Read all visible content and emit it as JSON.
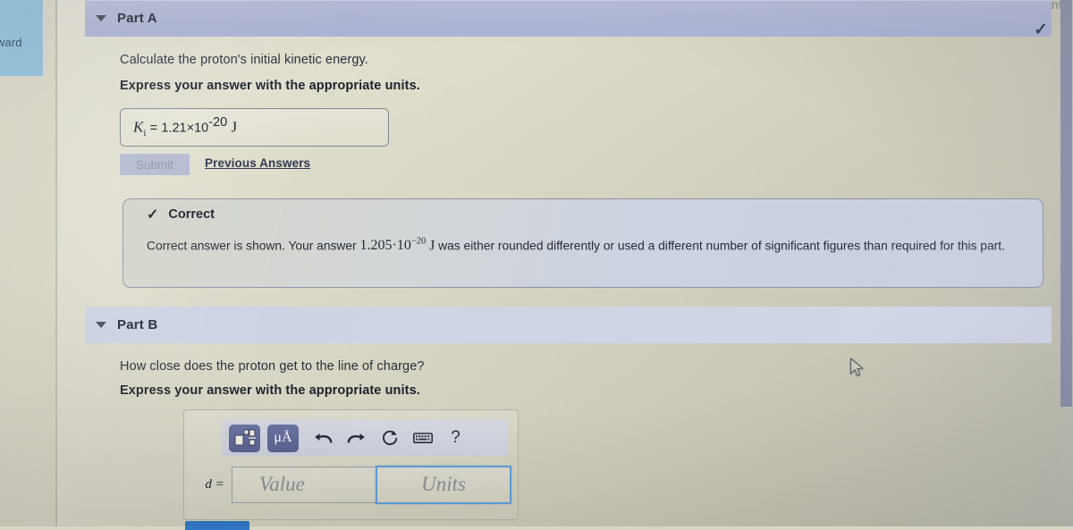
{
  "app": {
    "constants_label": "Constants",
    "left_nav_chip_text": "ward"
  },
  "part_a": {
    "title": "Part A",
    "caret_icon": "caret-down-icon",
    "status_icon": "check-icon",
    "question": "Calculate the proton's initial kinetic energy.",
    "instruction": "Express your answer with the appropriate units.",
    "answer": {
      "symbol": "K",
      "subscript": "i",
      "equals": "=",
      "mantissa": "1.21",
      "times": "×",
      "base": "10",
      "exponent": "-20",
      "unit": "J"
    },
    "submit_label": "Submit",
    "previous_answers_label": "Previous Answers",
    "feedback": {
      "icon": "check-icon",
      "title": "Correct",
      "text_before": "Correct answer is shown. Your answer",
      "value_mantissa": "1.205·10",
      "value_exponent": "−20",
      "value_unit": "J",
      "text_after": "was either rounded differently or used a different number of significant figures than required for this part."
    }
  },
  "part_b": {
    "title": "Part B",
    "caret_icon": "caret-down-icon",
    "question": "How close does the proton get to the line of charge?",
    "instruction": "Express your answer with the appropriate units.",
    "toolbar": [
      {
        "name": "template-icon",
        "glyph": ""
      },
      {
        "name": "units-icon",
        "glyph": "μÅ"
      },
      {
        "name": "undo-icon",
        "glyph": "↶"
      },
      {
        "name": "redo-icon",
        "glyph": "↷"
      },
      {
        "name": "reset-icon",
        "glyph": "↻"
      },
      {
        "name": "keyboard-icon",
        "glyph": "⌨"
      },
      {
        "name": "help-icon",
        "glyph": "?"
      }
    ],
    "variable_label": "d =",
    "value_placeholder": "Value",
    "units_placeholder": "Units",
    "value_current": "",
    "units_current": ""
  },
  "colors": {
    "part_a_header": "#b2b9d8",
    "part_b_header": "#cfd6e6",
    "feedback_border": "#8b94a8",
    "focus_blue": "#5f9fd8",
    "submit_blue": "#2f77c4",
    "nav_chip_blue": "#8cc0dd",
    "page_bg": "#d6d4c2"
  }
}
